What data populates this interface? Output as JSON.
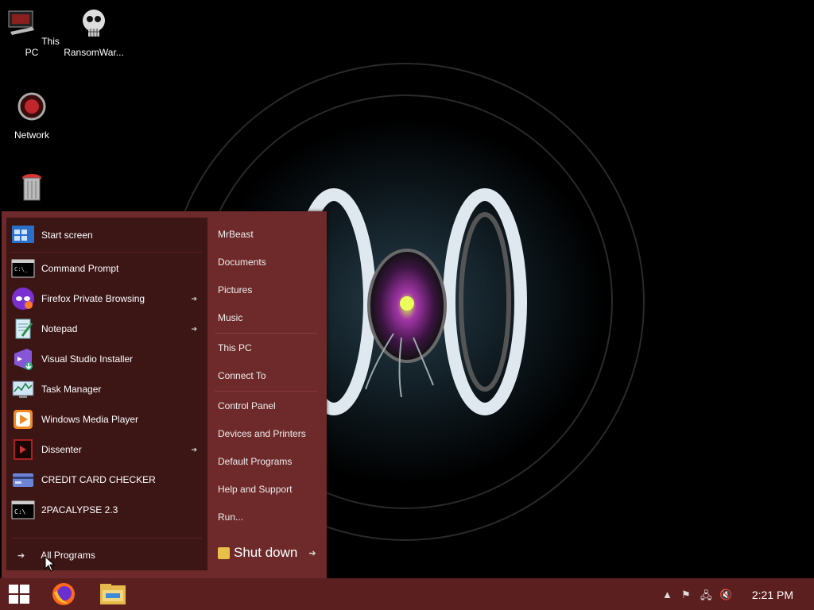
{
  "desktop": {
    "icons": [
      {
        "label": "This PC"
      },
      {
        "label": "RansomWar..."
      },
      {
        "label": "Network"
      },
      {
        "label": ""
      }
    ]
  },
  "start_menu": {
    "pinned": [
      {
        "label": "Start screen",
        "icon": "start-screen-icon",
        "has_submenu": false
      },
      {
        "label": "Command Prompt",
        "icon": "command-prompt-icon",
        "has_submenu": false
      },
      {
        "label": "Firefox Private Browsing",
        "icon": "firefox-private-icon",
        "has_submenu": true
      },
      {
        "label": "Notepad",
        "icon": "notepad-icon",
        "has_submenu": true
      },
      {
        "label": "Visual Studio Installer",
        "icon": "visual-studio-installer-icon",
        "has_submenu": false
      },
      {
        "label": "Task Manager",
        "icon": "task-manager-icon",
        "has_submenu": false
      },
      {
        "label": "Windows Media Player",
        "icon": "media-player-icon",
        "has_submenu": false
      },
      {
        "label": "Dissenter",
        "icon": "dissenter-icon",
        "has_submenu": true
      },
      {
        "label": "CREDIT CARD CHECKER",
        "icon": "credit-card-icon",
        "has_submenu": false
      },
      {
        "label": "2PACALYPSE 2.3",
        "icon": "console-app-icon",
        "has_submenu": false
      }
    ],
    "all_programs_label": "All Programs",
    "right_items": [
      {
        "label": "MrBeast"
      },
      {
        "label": "Documents"
      },
      {
        "label": "Pictures"
      },
      {
        "label": "Music"
      },
      {
        "label": "This PC"
      },
      {
        "label": "Connect To"
      },
      {
        "label": "Control Panel"
      },
      {
        "label": "Devices and Printers"
      },
      {
        "label": "Default Programs"
      },
      {
        "label": "Help and Support"
      },
      {
        "label": "Run..."
      }
    ],
    "shutdown_label": "Shut down"
  },
  "taskbar": {
    "clock": "2:21 PM",
    "pinned": [
      "windows-start-icon",
      "firefox-icon",
      "file-explorer-icon"
    ],
    "tray": [
      "chevron-up-icon",
      "action-center-flag-icon",
      "network-icon",
      "volume-muted-icon"
    ]
  },
  "colors": {
    "start_menu_bg": "#6e2a2a",
    "start_left_pane": "#3c1515",
    "taskbar_bg": "#5c1f1f"
  }
}
